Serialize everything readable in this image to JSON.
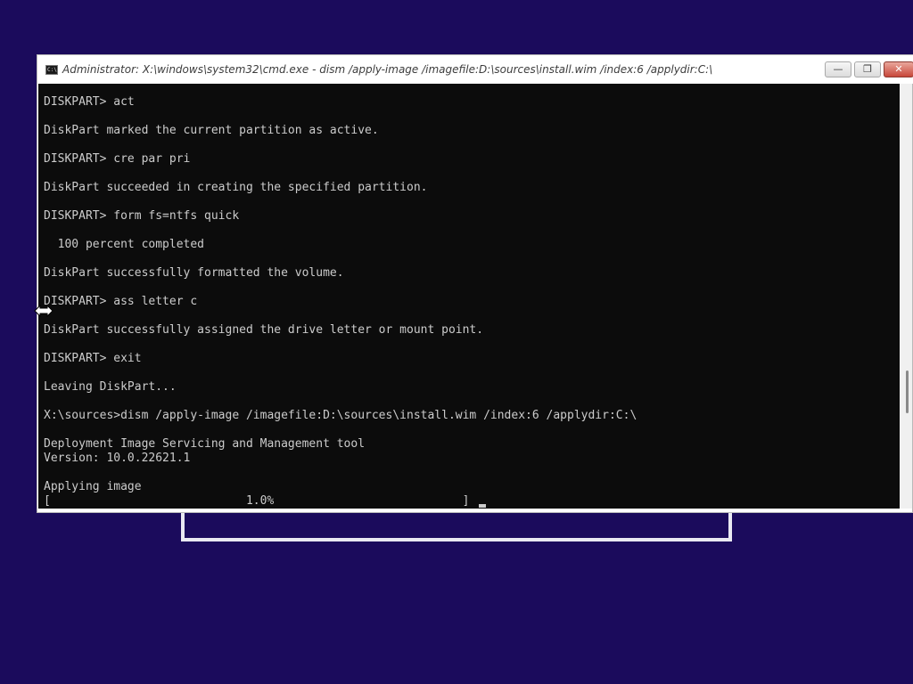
{
  "window": {
    "title": "Administrator: X:\\windows\\system32\\cmd.exe - dism  /apply-image /imagefile:D:\\sources\\install.wim /index:6 /applydir:C:\\",
    "icon_glyph": "C:\\",
    "minimize_label": "—",
    "maximize_label": "❐",
    "close_label": "✕"
  },
  "console": {
    "lines": [
      "DISKPART> act",
      "",
      "DiskPart marked the current partition as active.",
      "",
      "DISKPART> cre par pri",
      "",
      "DiskPart succeeded in creating the specified partition.",
      "",
      "DISKPART> form fs=ntfs quick",
      "",
      "  100 percent completed",
      "",
      "DiskPart successfully formatted the volume.",
      "",
      "DISKPART> ass letter c",
      "",
      "DiskPart successfully assigned the drive letter or mount point.",
      "",
      "DISKPART> exit",
      "",
      "Leaving DiskPart...",
      "",
      "X:\\sources>dism /apply-image /imagefile:D:\\sources\\install.wim /index:6 /applydir:C:\\",
      "",
      "Deployment Image Servicing and Management tool",
      "Version: 10.0.22621.1",
      "",
      "Applying image",
      "[                            1.0%                           ]"
    ]
  },
  "icons": {
    "window_icon": "console-icon",
    "cursor_icon": "resize-horizontal-icon"
  },
  "colors": {
    "desktop_bg": "#1b0b5c",
    "console_bg": "#0c0c0c",
    "console_text": "#cccccc",
    "close_button": "#c8473a"
  }
}
